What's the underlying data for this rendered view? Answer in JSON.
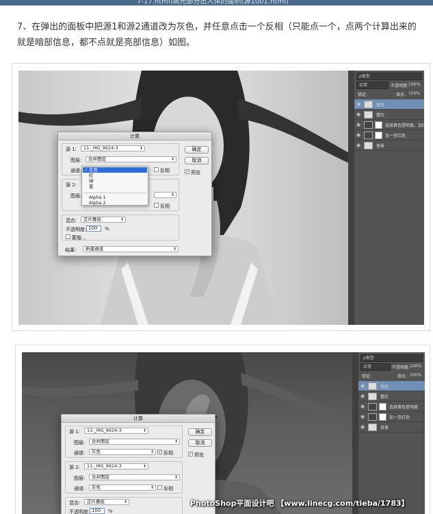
{
  "page": {
    "top_text": "7-17.html)高光部分出人体的面积(源1001.html)",
    "instruction": "7、在弹出的面板中把源1和源2通道改为灰色，并任意点击一个反相（只能点一个，点两个计算出来的就是暗部信息，都不点就是亮部信息）如图。"
  },
  "dialog": {
    "title": "计算",
    "source1_label": "源 1:",
    "source1_value": "11-_MG_9624-3",
    "layer_label": "图层:",
    "layer_value": "合并图层",
    "channel_label": "通道:",
    "channel_value": "灰色",
    "invert_label": "反相",
    "source2_label": "源 2:",
    "source2_value": "11-_MG_9624-3",
    "blend_label": "混合:",
    "blend_value": "正片叠底",
    "opacity_label": "不透明度:",
    "opacity_value": "100",
    "opacity_unit": "%",
    "mask_label": "蒙版...",
    "result_label": "结果:",
    "result_value": "新建通道",
    "ok_button": "确定",
    "cancel_button": "取消",
    "preview_label": "预览",
    "channel_options": [
      "灰色",
      "红",
      "绿",
      "蓝",
      "Alpha 1",
      "Alpha 2"
    ]
  },
  "panel": {
    "filter": "ρ类型",
    "blend_mode": "正常",
    "opacity_label": "不透明度:",
    "opacity_value": "100%",
    "lock_label": "锁定:",
    "fill_label": "填充:",
    "fill_value": "100%",
    "layers": [
      "锐化",
      "蒙红",
      "选择黄色提明度，加红",
      "加一杏红色",
      "背景"
    ]
  },
  "panel2": {
    "layers": [
      "锐化",
      "蒙红",
      "选择黄色提明度",
      "加一杏红色",
      "背景"
    ]
  },
  "watermark": "PhotoShop平面设计吧 【www.linecg.com/tieba/1783】"
}
